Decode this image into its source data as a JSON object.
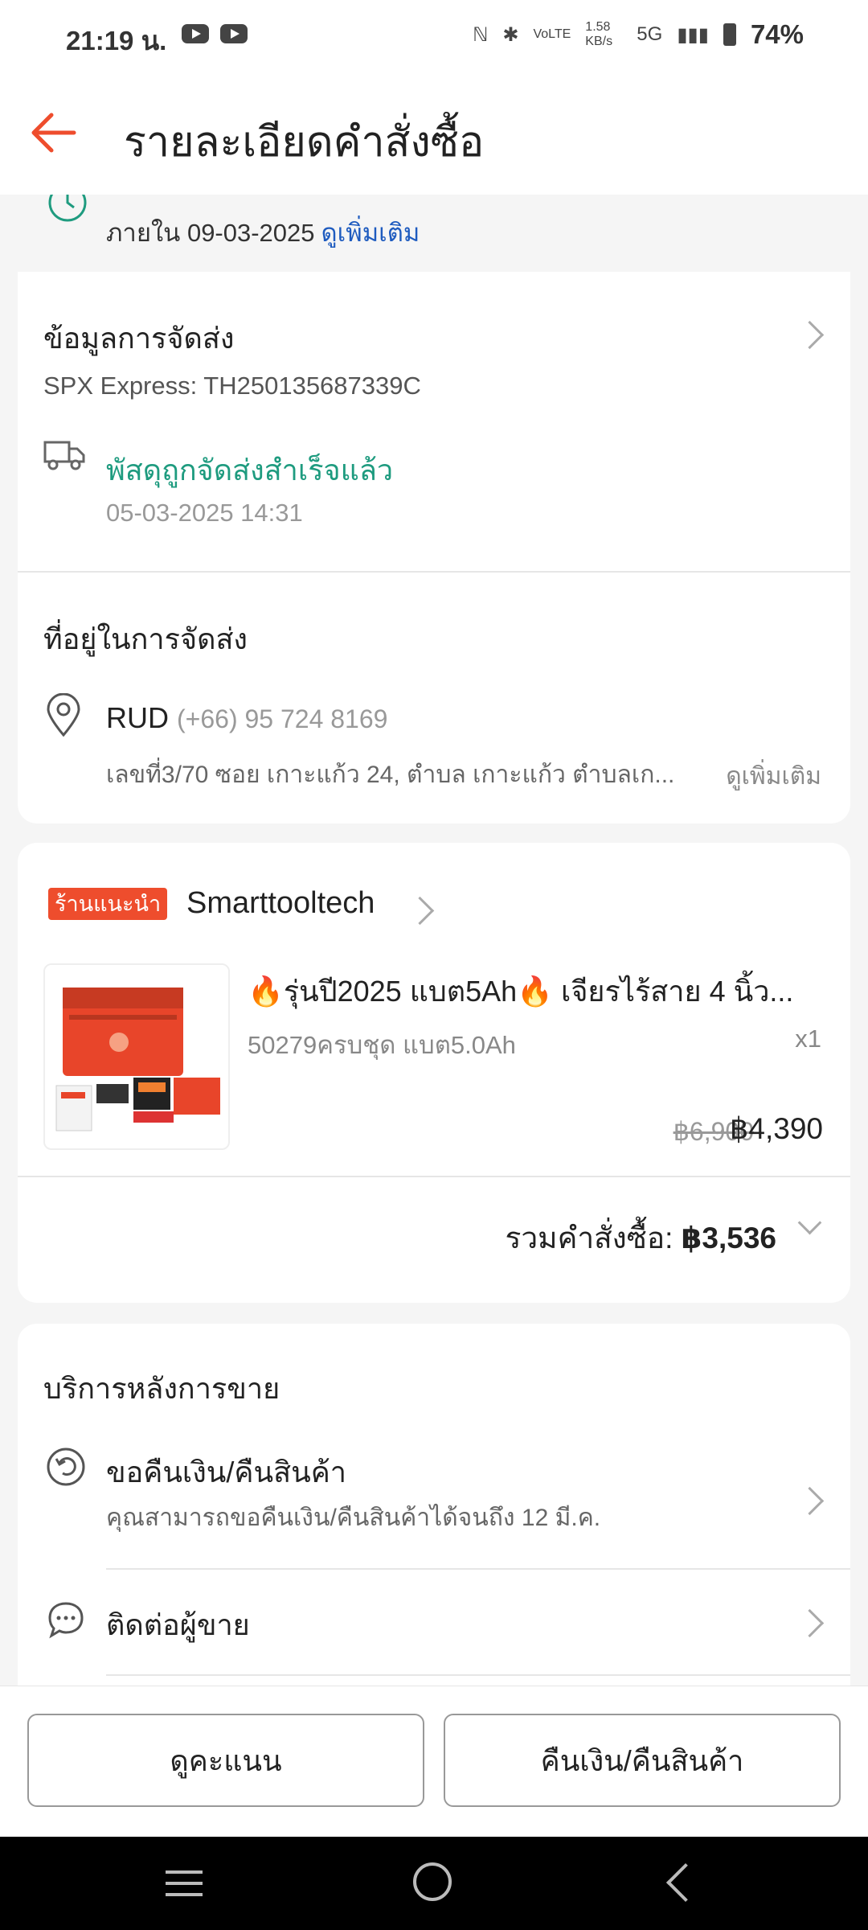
{
  "status": {
    "time": "21:19 น.",
    "speed": "1.58 KB/s",
    "network": "5G",
    "battery": "74%"
  },
  "header": {
    "title": "รายละเอียดคำสั่งซื้อ"
  },
  "notice": {
    "text": "ภายใน 09-03-2025",
    "link": "ดูเพิ่มเติม"
  },
  "shipping": {
    "title": "ข้อมูลการจัดส่ง",
    "carrier": "SPX Express: TH250135687339C",
    "status": "พัสดุถูกจัดส่งสำเร็จแล้ว",
    "time": "05-03-2025 14:31"
  },
  "address": {
    "title": "ที่อยู่ในการจัดส่ง",
    "name": "RUD",
    "phone": "(+66) 95 724 8169",
    "line": "เลขที่3/70 ซอย เกาะแก้ว 24, ตำบล เกาะแก้ว ตำบลเก...",
    "more": "ดูเพิ่มเติม"
  },
  "shop": {
    "badge": "ร้านแนะนำ",
    "name": "Smarttooltech"
  },
  "product": {
    "name": "🔥รุ่นปี2025 แบต5Ah🔥 เจียรไร้สาย 4 นิ้ว...",
    "variant": "50279ครบชุด แบต5.0Ah",
    "qty": "x1",
    "price_old": "฿6,900",
    "price_new": "฿4,390"
  },
  "order": {
    "total_label": "รวมคำสั่งซื้อ:",
    "total_value": "฿3,536"
  },
  "after_sales": {
    "title": "บริการหลังการขาย",
    "refund_title": "ขอคืนเงิน/คืนสินค้า",
    "refund_sub": "คุณสามารถขอคืนเงิน/คืนสินค้าได้จนถึง 12 มี.ค.",
    "contact_title": "ติดต่อผู้ขาย"
  },
  "actions": {
    "rate": "ดูคะแนน",
    "refund": "คืนเงิน/คืนสินค้า"
  },
  "colors": {
    "accent": "#ee4d2d",
    "success": "#1e9b7f",
    "link": "#1e5bbf"
  }
}
